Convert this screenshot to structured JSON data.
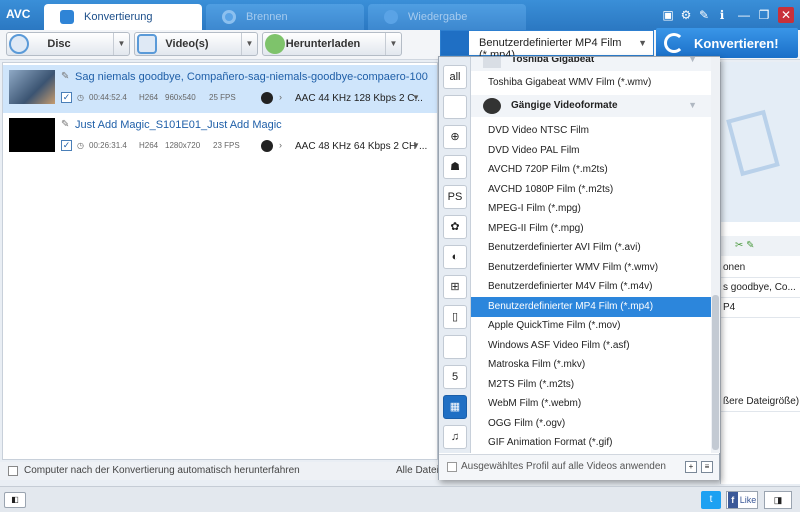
{
  "window": {
    "logo": "AVC",
    "controls": [
      "▣",
      "⚙",
      "✎",
      "ℹ",
      "—",
      "❐",
      "✕"
    ]
  },
  "tabs": [
    {
      "label": "Konvertierung",
      "active": true
    },
    {
      "label": "Brennen",
      "active": false
    },
    {
      "label": "Wiedergabe",
      "active": false
    }
  ],
  "toolbar": {
    "disc_label": "Disc",
    "videos_label": "Video(s)",
    "download_label": "Herunterladen"
  },
  "profile": {
    "selected": "Benutzerdefinierter MP4 Film (*.mp4)"
  },
  "convert_button": "Konvertieren!",
  "files": [
    {
      "name": "Sag niemals goodbye, Compañero-sag-niemals-goodbye-compaero-100",
      "duration": "00:44:52.4",
      "codec": "H264",
      "resolution": "960x540",
      "fps": "25 FPS",
      "audio": "AAC 44 KHz 128 Kbps 2 C..."
    },
    {
      "name": "Just Add Magic_S101E01_Just Add Magic",
      "duration": "00:26:31.4",
      "codec": "H264",
      "resolution": "1280x720",
      "fps": "23 FPS",
      "audio": "AAC 48 KHz 64 Kbps 2 CH ..."
    }
  ],
  "status": {
    "shutdown_label": "Computer nach der Konvertierung automatisch herunterfahren",
    "right_text": "Alle Datei"
  },
  "dropdown": {
    "group_top": "Toshiba Gigabeat",
    "toshiba_item": "Toshiba Gigabeat WMV Film (*.wmv)",
    "group_common": "Gängige Videoformate",
    "items": [
      "DVD Video NTSC Film",
      "DVD Video PAL Film",
      "AVCHD 720P Film (*.m2ts)",
      "AVCHD 1080P Film (*.m2ts)",
      "MPEG-I Film (*.mpg)",
      "MPEG-II Film (*.mpg)",
      "Benutzerdefinierter AVI Film (*.avi)",
      "Benutzerdefinierter WMV Film (*.wmv)",
      "Benutzerdefinierter M4V Film (*.m4v)",
      "Benutzerdefinierter MP4 Film (*.mp4)",
      "Apple QuickTime Film (*.mov)",
      "Windows ASF Video Film (*.asf)",
      "Matroska Film (*.mkv)",
      "M2TS Film (*.m2ts)",
      "WebM Film (*.webm)",
      "OGG Film (*.ogv)",
      "GIF Animation Format (*.gif)"
    ],
    "selected_index": 9,
    "apply_all_label": "Ausgewähltes Profil auf alle Videos anwenden",
    "categories": [
      "all",
      "apple",
      "android-s",
      "android",
      "playstation",
      "huawei",
      "lg",
      "windows",
      "phone",
      "tv",
      "html5",
      "video",
      "music"
    ],
    "category_glyphs": [
      "all",
      "",
      "⊕",
      "☗",
      "PS",
      "✿",
      "◐",
      "⊞",
      "▯",
      "📺",
      "5",
      "▦",
      "♫"
    ]
  },
  "right_panel": {
    "rows": [
      "onen",
      "s goodbye, Co...",
      "P4"
    ],
    "size_label": "ßere Dateigröße)"
  },
  "footer": {
    "tw": "t",
    "like": "Like"
  }
}
